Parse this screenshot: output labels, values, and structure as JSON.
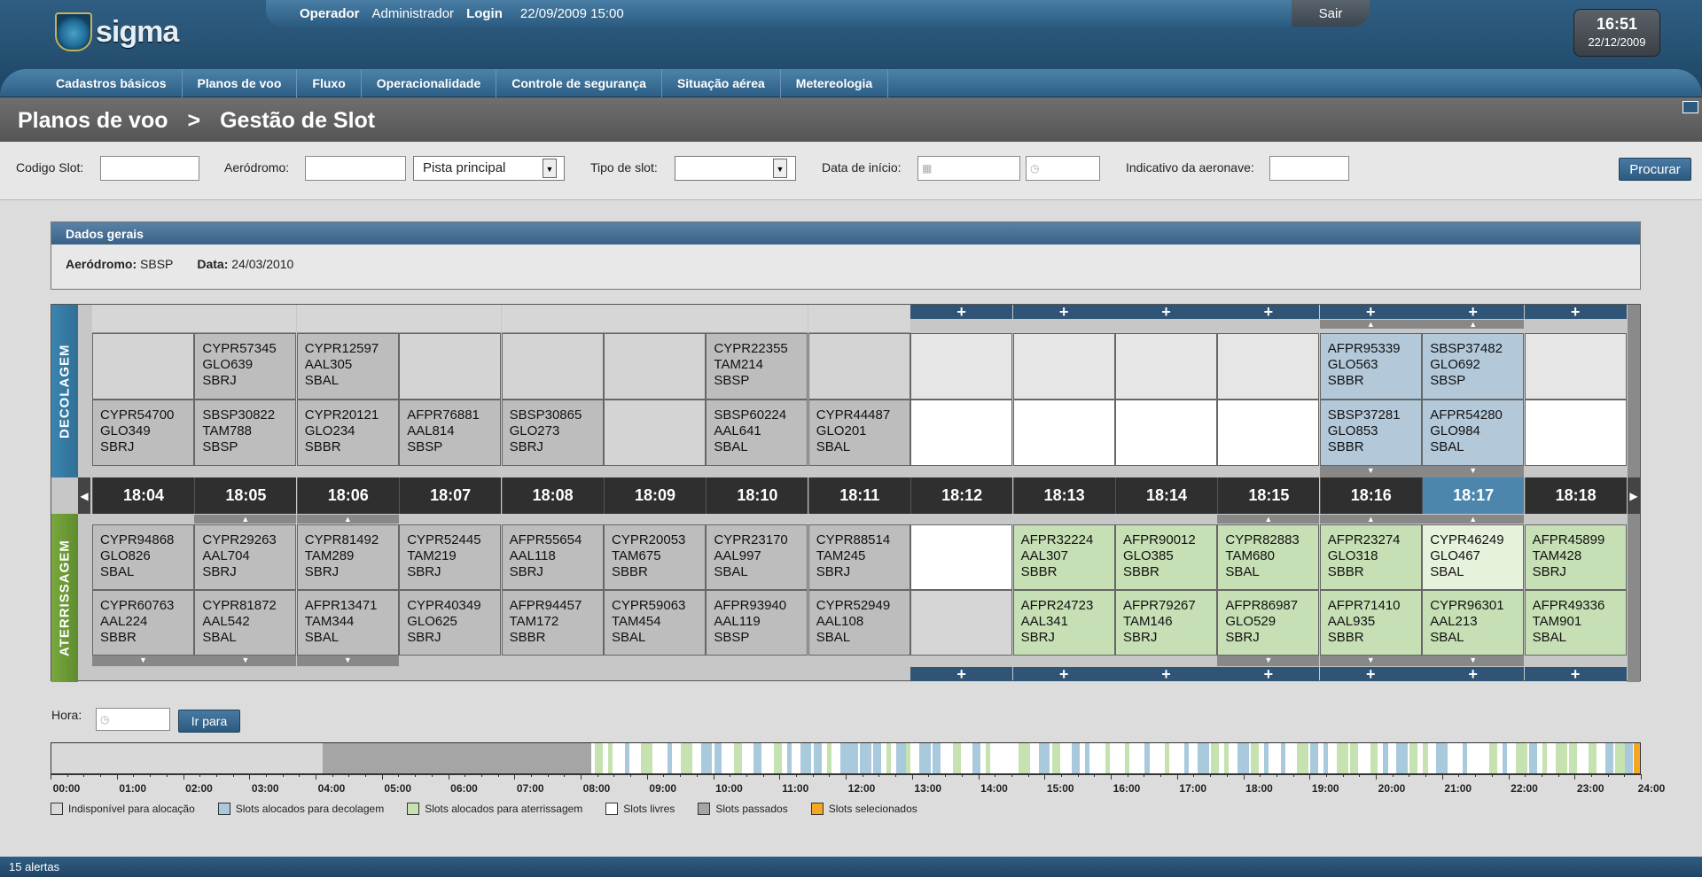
{
  "app": {
    "name": "sigma"
  },
  "userbar": {
    "operador_label": "Operador",
    "operador_value": "Administrador",
    "login_label": "Login",
    "login_datetime": "22/09/2009 15:00",
    "logout": "Sair"
  },
  "clock": {
    "time": "16:51",
    "date": "22/12/2009"
  },
  "nav": [
    "Cadastros básicos",
    "Planos de voo",
    "Fluxo",
    "Operacionalidade",
    "Controle de segurança",
    "Situação aérea",
    "Metereologia"
  ],
  "breadcrumb": {
    "parent": "Planos de voo",
    "separator": ">",
    "current": "Gestão de Slot"
  },
  "filters": {
    "codigo_slot": "Codigo Slot:",
    "aerodromo": "Aeródromo:",
    "pista": "Pista principal",
    "tipo_slot": "Tipo de slot:",
    "data_inicio": "Data de início:",
    "indicativo": "Indicativo da aeronave:",
    "search_button": "Procurar"
  },
  "dados": {
    "title": "Dados gerais",
    "aerodromo_label": "Aeródromo:",
    "aerodromo": "SBSP",
    "data_label": "Data:",
    "data": "24/03/2010"
  },
  "grid": {
    "decolagem_label": "DECOLAGEM",
    "aterrissagem_label": "ATERRISSAGEM",
    "plus": "+",
    "columns": [
      {
        "time": "18:04",
        "dep_top": "",
        "dep_bot": "CYPR54700\nGLO349\nSBRJ",
        "arr_top": "CYPR94868\nGLO826\nSBAL",
        "arr_bot": "CYPR60763\nAAL224\nSBBR"
      },
      {
        "time": "18:05",
        "dep_top": "CYPR57345\nGLO639\nSBRJ",
        "dep_bot": "SBSP30822\nTAM788\nSBSP",
        "arr_top": "CYPR29263\nAAL704\nSBRJ",
        "arr_bot": "CYPR81872\nAAL542\nSBAL"
      },
      {
        "time": "18:06",
        "dep_top": "CYPR12597\nAAL305\nSBAL",
        "dep_bot": "CYPR20121\nGLO234\nSBBR",
        "arr_top": "CYPR81492\nTAM289\nSBRJ",
        "arr_bot": "AFPR13471\nTAM344\nSBAL"
      },
      {
        "time": "18:07",
        "dep_top": "",
        "dep_bot": "AFPR76881\nAAL814\nSBSP",
        "arr_top": "CYPR52445\nTAM219\nSBRJ",
        "arr_bot": "CYPR40349\nGLO625\nSBRJ"
      },
      {
        "time": "18:08",
        "dep_top": "",
        "dep_bot": "SBSP30865\nGLO273\nSBRJ",
        "arr_top": "AFPR55654\nAAL118\nSBRJ",
        "arr_bot": "AFPR94457\nTAM172\nSBBR"
      },
      {
        "time": "18:09",
        "dep_top": "",
        "dep_bot": "",
        "arr_top": "CYPR20053\nTAM675\nSBBR",
        "arr_bot": "CYPR59063\nTAM454\nSBAL"
      },
      {
        "time": "18:10",
        "dep_top": "CYPR22355\nTAM214\nSBSP",
        "dep_bot": "SBSP60224\nAAL641\nSBAL",
        "arr_top": "CYPR23170\nAAL997\nSBAL",
        "arr_bot": "AFPR93940\nAAL119\nSBSP"
      },
      {
        "time": "18:11",
        "dep_top": "",
        "dep_bot": "CYPR44487\nGLO201\nSBAL",
        "arr_top": "CYPR88514\nTAM245\nSBRJ",
        "arr_bot": "CYPR52949\nAAL108\nSBAL"
      },
      {
        "time": "18:12",
        "dep_top": "",
        "dep_bot": "",
        "arr_top": "",
        "arr_bot": ""
      },
      {
        "time": "18:13",
        "dep_top": "",
        "dep_bot": "",
        "arr_top": "AFPR32224\nAAL307\nSBBR",
        "arr_bot": "AFPR24723\nAAL341\nSBRJ"
      },
      {
        "time": "18:14",
        "dep_top": "",
        "dep_bot": "",
        "arr_top": "AFPR90012\nGLO385\nSBBR",
        "arr_bot": "AFPR79267\nTAM146\nSBRJ"
      },
      {
        "time": "18:15",
        "dep_top": "",
        "dep_bot": "",
        "arr_top": "CYPR82883\nTAM680\nSBAL",
        "arr_bot": "AFPR86987\nGLO529\nSBRJ"
      },
      {
        "time": "18:16",
        "dep_top": "AFPR95339\nGLO563\nSBBR",
        "dep_bot": "SBSP37281\nGLO853\nSBBR",
        "arr_top": "AFPR23274\nGLO318\nSBBR",
        "arr_bot": "AFPR71410\nAAL935\nSBBR"
      },
      {
        "time": "18:17",
        "dep_top": "SBSP37482\nGLO692\nSBSP",
        "dep_bot": "AFPR54280\nGLO984\nSBAL",
        "arr_top": "CYPR46249\nGLO467\nSBAL",
        "arr_bot": "CYPR96301\nAAL213\nSBAL"
      },
      {
        "time": "18:18",
        "dep_top": "",
        "dep_bot": "",
        "arr_top": "AFPR45899\nTAM428\nSBRJ",
        "arr_bot": "AFPR49336\nTAM901\nSBAL"
      }
    ]
  },
  "hora": {
    "label": "Hora:",
    "button": "Ir para"
  },
  "timeline": {
    "hours": [
      "00:00",
      "01:00",
      "02:00",
      "03:00",
      "04:00",
      "05:00",
      "06:00",
      "07:00",
      "08:00",
      "09:00",
      "10:00",
      "11:00",
      "12:00",
      "13:00",
      "14:00",
      "15:00",
      "16:00",
      "17:00",
      "18:00",
      "19:00",
      "20:00",
      "21:00",
      "22:00",
      "23:00",
      "24:00"
    ]
  },
  "legend": [
    {
      "label": "Indisponível para alocação",
      "color": "#d9d9d9"
    },
    {
      "label": "Slots alocados para decolagem",
      "color": "#a9c9dc"
    },
    {
      "label": "Slots alocados para aterrissagem",
      "color": "#c6e2b0"
    },
    {
      "label": "Slots livres",
      "color": "#ffffff"
    },
    {
      "label": "Slots passados",
      "color": "#a5a5a5"
    },
    {
      "label": "Slots selecionados",
      "color": "#f5a623"
    }
  ],
  "footer": {
    "alerts": "15 alertas"
  }
}
